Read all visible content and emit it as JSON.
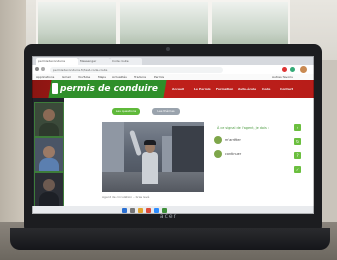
{
  "browser": {
    "tabs": [
      {
        "label": "permisdeconduire",
        "active": true
      },
      {
        "label": "Messenger",
        "active": false
      },
      {
        "label": "Code route",
        "active": false
      }
    ],
    "url": "permisdeconduire.fr/test-code-route",
    "bookmarks": [
      "Applications",
      "Gmail",
      "YouTube",
      "Maps",
      "Actualités",
      "Traduire",
      "Permis",
      "Autres favoris"
    ]
  },
  "site": {
    "logo_text": "permis de conduire",
    "nav": [
      "Accueil",
      "Le Permis",
      "Formation",
      "Auto-école",
      "Code",
      "Contact"
    ],
    "content_tabs": [
      {
        "label": "Les questions",
        "color": "#5fb93a"
      },
      {
        "label": "Les thèmes",
        "color": "#9aa3ad"
      }
    ],
    "question": "À ce signal de l'agent, je dois :",
    "answers": [
      {
        "label": "A",
        "text": "m'arrêter"
      },
      {
        "label": "B",
        "text": "continuer"
      }
    ],
    "caption": "Agent de circulation – bras levé"
  },
  "laptop_brand": "acer",
  "colors": {
    "site_red": "#c0201b",
    "site_green": "#2f8f2a",
    "accent_green": "#6bbf3f"
  }
}
